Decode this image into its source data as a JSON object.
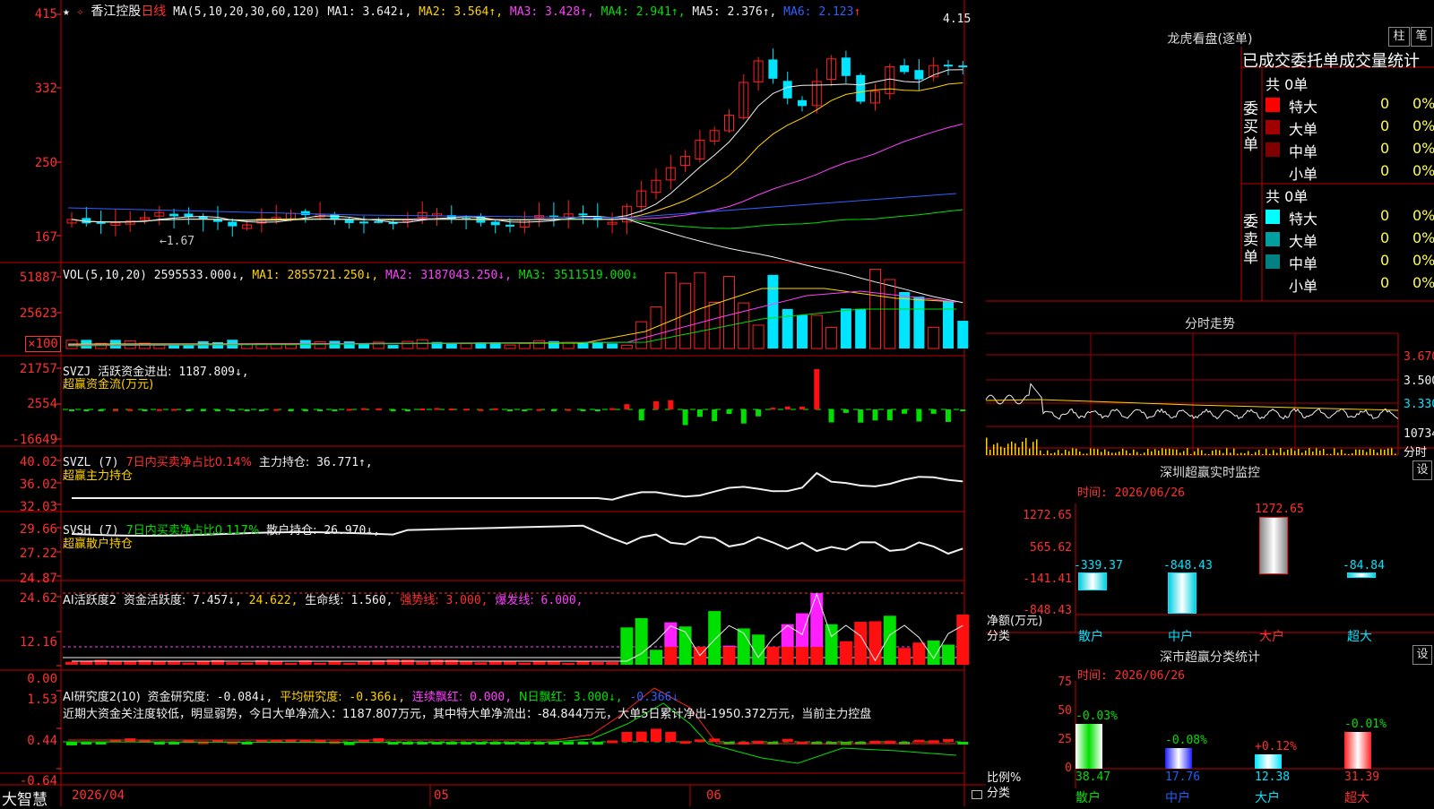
{
  "stock": {
    "name": "香江控股",
    "period": "日线",
    "ma_params": "MA(5,10,20,30,60,120)"
  },
  "main_pane": {
    "ma_values": [
      {
        "label": "MA1:",
        "value": "3.642",
        "dir": "↓",
        "color": "#f0f0f0"
      },
      {
        "label": "MA2:",
        "value": "3.564",
        "dir": "↑",
        "color": "#ffd200"
      },
      {
        "label": "MA3:",
        "value": "3.428",
        "dir": "↑",
        "color": "#ff40ff"
      },
      {
        "label": "MA4:",
        "value": "2.941",
        "dir": "↑",
        "color": "#00e000"
      },
      {
        "label": "MA5:",
        "value": "2.376",
        "dir": "↑",
        "color": "#f0f0f0"
      },
      {
        "label": "MA6:",
        "value": "2.123",
        "dir": "↑",
        "color": "#3060ff"
      }
    ],
    "y_labels": [
      "415",
      "332",
      "250",
      "167"
    ],
    "high_marker": "4.15",
    "low_marker": "←1.67"
  },
  "vol_pane": {
    "title": "VOL(5,10,20)",
    "value": "2595533.000↓,",
    "ma": [
      {
        "label": "MA1:",
        "value": "2855721.250↓,",
        "color": "#ffd200"
      },
      {
        "label": "MA2:",
        "value": "3187043.250↓,",
        "color": "#ff40ff"
      },
      {
        "label": "MA3:",
        "value": "3511519.000↓",
        "color": "#00e000"
      }
    ],
    "y_labels": [
      "51887",
      "25623"
    ],
    "unit": "×100"
  },
  "svzj_pane": {
    "title": "SVZJ",
    "label": "活跃资金进出:",
    "value": "1187.809↓,",
    "subtitle": "超赢资金流(万元)",
    "y_labels": [
      "21757",
      "2554",
      "-16649"
    ]
  },
  "svzl_pane": {
    "title": "SVZL (7)",
    "ratio_text": "7日内买卖净占比0.14%",
    "label": "主力持仓:",
    "value": "36.771↑,",
    "subtitle": "超赢主力持仓",
    "y_labels": [
      "40.02",
      "36.02",
      "32.03"
    ]
  },
  "svsh_pane": {
    "title": "SVSH (7)",
    "ratio_text": "7日内买卖净占比0.117%",
    "label": "散户持仓:",
    "value": "26.970↓,",
    "subtitle": "超赢散户持仓",
    "y_labels": [
      "29.66",
      "27.22",
      "24.87"
    ]
  },
  "ai_active_pane": {
    "title": "AI活跃度2",
    "label": "资金活跃度:",
    "value": "7.457↓,",
    "value2": "24.622,",
    "life_label": "生命线:",
    "life_value": "1.560,",
    "strong_label": "强势线:",
    "strong_value": "3.000,",
    "burst_label": "爆发线:",
    "burst_value": "6.000,",
    "y_labels": [
      "24.62",
      "12.16",
      "0.00"
    ]
  },
  "ai_research_pane": {
    "title": "AI研究度2(10)",
    "label": "资金研究度:",
    "value": "-0.084↓,",
    "avg_label": "平均研究度:",
    "avg_value": "-0.366↓,",
    "cont_label": "连续飘红:",
    "cont_value": "0.000,",
    "n_label": "N日飘红:",
    "n_value": "3.000↓,",
    "last_value": "-0.366↓",
    "comment": "近期大资金关注度较低，明显弱势，今日大单净流入：1187.807万元，其中特大单净流出：-84.844万元，大单5日累计净出-1950.372万元，当前主力控盘",
    "y_labels": [
      "1.53",
      "0.44",
      "-0.64"
    ]
  },
  "bottom_bar": {
    "brand": "大智慧",
    "dates": [
      "2026/04",
      "05",
      "06"
    ]
  },
  "dragon_tiger": {
    "title": "龙虎看盘(逐单)",
    "btn1": "柱",
    "btn2": "笔",
    "tabs": [
      "已成交",
      "委托单",
      "成交量统计"
    ],
    "buy_label": "委买单",
    "sell_label": "委卖单",
    "buy_total": "共 0单",
    "sell_total": "共 0单",
    "buy_rows": [
      {
        "name": "特大",
        "count": "0",
        "pct": "0%",
        "color": "#ff0000"
      },
      {
        "name": "大单",
        "count": "0",
        "pct": "0%",
        "color": "#a00000"
      },
      {
        "name": "中单",
        "count": "0",
        "pct": "0%",
        "color": "#800000"
      },
      {
        "name": "小单",
        "count": "0",
        "pct": "0%",
        "color": ""
      }
    ],
    "sell_rows": [
      {
        "name": "特大",
        "count": "0",
        "pct": "0%",
        "color": "#00ffff"
      },
      {
        "name": "大单",
        "count": "0",
        "pct": "0%",
        "color": "#00a0a0"
      },
      {
        "name": "中单",
        "count": "0",
        "pct": "0%",
        "color": "#008080"
      },
      {
        "name": "小单",
        "count": "0",
        "pct": "0%",
        "color": ""
      }
    ]
  },
  "intraday": {
    "title": "分时走势",
    "y_labels": [
      "3.670",
      "3.500",
      "3.330",
      "10734"
    ],
    "unit": "分时"
  },
  "sz_monitor": {
    "title": "深圳超赢实时监控",
    "set": "设",
    "time": "时间: 2026/06/26",
    "y_labels": [
      "1272.65",
      "565.62",
      "-141.41",
      "-848.43"
    ],
    "y_title": "净额(万元)",
    "x_title": "分类",
    "categories": [
      "散户",
      "中户",
      "大户",
      "超大"
    ],
    "values": [
      -339.37,
      -848.43,
      1272.65,
      -84.84
    ],
    "value_labels": [
      "-339.37",
      "-848.43",
      "1272.65",
      "-84.84"
    ]
  },
  "sz_stat": {
    "title": "深市超赢分类统计",
    "set": "设",
    "time": "时间: 2026/06/26",
    "y_labels": [
      "75",
      "50",
      "25",
      "0"
    ],
    "y_title": "比例%",
    "x_title": "分类",
    "categories": [
      "散户",
      "中户",
      "大户",
      "超大"
    ],
    "values": [
      38.47,
      17.76,
      12.38,
      31.39
    ],
    "value_labels": [
      "38.47",
      "17.76",
      "12.38",
      "31.39"
    ],
    "change_labels": [
      "-0.03%",
      "-0.08%",
      "+0.12%",
      "-0.01%"
    ]
  }
}
